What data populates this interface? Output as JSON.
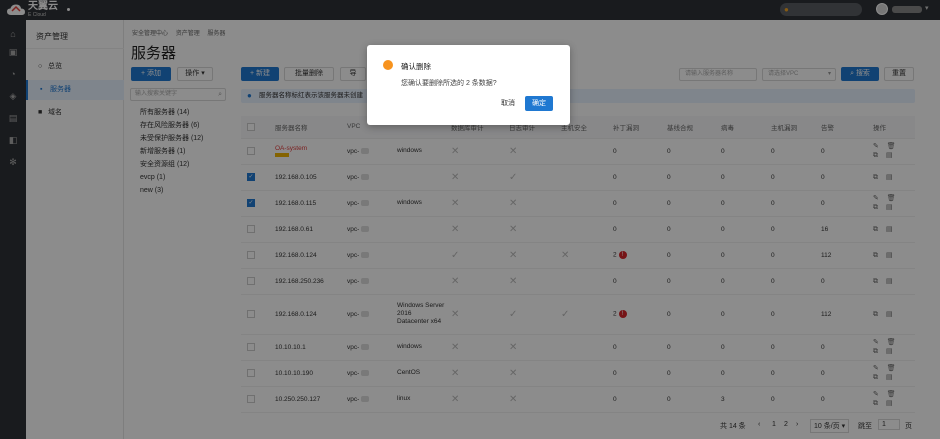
{
  "brand": {
    "name": "天翼云",
    "sub": "E Cloud"
  },
  "nav": {
    "title": "资产管理",
    "items": [
      {
        "icon": "radio-icon",
        "label": "总览"
      },
      {
        "icon": "server-icon",
        "label": "服务器"
      },
      {
        "icon": "square-icon",
        "label": "域名"
      }
    ]
  },
  "breadcrumb": [
    "安全管理中心",
    "资产管理",
    "服务器"
  ],
  "page": {
    "title": "服务器"
  },
  "left_toolbar": {
    "add_label": "+ 添加",
    "ops_label": "操作 ▾"
  },
  "group_search": {
    "placeholder": "输入搜索关键字"
  },
  "groups": [
    "所有服务器 (14)",
    "存在风险服务器 (6)",
    "未受保护服务器 (12)",
    "新增服务器 (1)",
    "安全资源组 (12)",
    "evcp (1)",
    "new (3)"
  ],
  "toolbar": {
    "new_label": "+ 新建",
    "batch_delete_label": "批量删除",
    "third_label": "导"
  },
  "filters": {
    "server_name_placeholder": "请输入服务器名称",
    "vpc_placeholder": "请选择VPC",
    "search_label": "搜索",
    "reset_label": "重置"
  },
  "info": {
    "text": "服务器名称标红表示该服务器未创建"
  },
  "table": {
    "headers": [
      "",
      "服务器名称",
      "VPC",
      "",
      "数据库审计",
      "日志审计",
      "主机安全",
      "补丁漏洞",
      "基线合规",
      "病毒",
      "主机漏洞",
      "告警",
      "操作"
    ],
    "rows": [
      {
        "checked": false,
        "name": "OA-system",
        "red": true,
        "tag": true,
        "vpc": "vpc-",
        "os": "windows",
        "db": "✕",
        "log": "✕",
        "host": "",
        "patch": "0",
        "warn": false,
        "baseline": "0",
        "virus": "0",
        "hostvul": "0",
        "alarm": "0",
        "ops": "✎ 🗑\n⧉ ▤",
        "tall": false
      },
      {
        "checked": true,
        "name": "192.168.0.105",
        "red": false,
        "tag": false,
        "vpc": "vpc-",
        "os": "",
        "db": "✕",
        "log": "✓",
        "host": "",
        "patch": "0",
        "warn": false,
        "baseline": "0",
        "virus": "0",
        "hostvul": "0",
        "alarm": "0",
        "ops": "⧉ ▤",
        "tall": false
      },
      {
        "checked": true,
        "name": "192.168.0.115",
        "red": false,
        "tag": false,
        "vpc": "vpc-",
        "os": "windows",
        "db": "✕",
        "log": "✕",
        "host": "",
        "patch": "0",
        "warn": false,
        "baseline": "0",
        "virus": "0",
        "hostvul": "0",
        "alarm": "0",
        "ops": "✎ 🗑\n⧉ ▤",
        "tall": false
      },
      {
        "checked": false,
        "name": "192.168.0.61",
        "red": false,
        "tag": false,
        "vpc": "vpc-",
        "os": "",
        "db": "✕",
        "log": "✕",
        "host": "",
        "patch": "0",
        "warn": false,
        "baseline": "0",
        "virus": "0",
        "hostvul": "0",
        "alarm": "16",
        "ops": "⧉ ▤",
        "tall": false
      },
      {
        "checked": false,
        "name": "192.168.0.124",
        "red": false,
        "tag": false,
        "vpc": "vpc-",
        "os": "",
        "db": "✓",
        "log": "✕",
        "host": "✕",
        "patch": "2",
        "warn": true,
        "baseline": "0",
        "virus": "0",
        "hostvul": "0",
        "alarm": "112",
        "ops": "⧉ ▤",
        "tall": false
      },
      {
        "checked": false,
        "name": "192.168.250.236",
        "red": false,
        "tag": false,
        "vpc": "vpc-",
        "os": "",
        "db": "✕",
        "log": "✕",
        "host": "",
        "patch": "0",
        "warn": false,
        "baseline": "0",
        "virus": "0",
        "hostvul": "0",
        "alarm": "0",
        "ops": "⧉ ▤",
        "tall": false
      },
      {
        "checked": false,
        "name": "192.168.0.124",
        "red": false,
        "tag": false,
        "vpc": "vpc-",
        "os": "Windows Server 2016 Datacenter x64",
        "db": "✕",
        "log": "✓",
        "host": "✓",
        "patch": "2",
        "warn": true,
        "baseline": "0",
        "virus": "0",
        "hostvul": "0",
        "alarm": "112",
        "ops": "⧉ ▤",
        "tall": true
      },
      {
        "checked": false,
        "name": "10.10.10.1",
        "red": false,
        "tag": false,
        "vpc": "vpc-",
        "os": "windows",
        "db": "✕",
        "log": "✕",
        "host": "",
        "patch": "0",
        "warn": false,
        "baseline": "0",
        "virus": "0",
        "hostvul": "0",
        "alarm": "0",
        "ops": "✎ 🗑\n⧉ ▤",
        "tall": false
      },
      {
        "checked": false,
        "name": "10.10.10.190",
        "red": false,
        "tag": false,
        "vpc": "vpc-",
        "os": "CentOS",
        "db": "✕",
        "log": "✕",
        "host": "",
        "patch": "0",
        "warn": false,
        "baseline": "0",
        "virus": "0",
        "hostvul": "0",
        "alarm": "0",
        "ops": "✎ 🗑\n⧉ ▤",
        "tall": false
      },
      {
        "checked": false,
        "name": "10.250.250.127",
        "red": false,
        "tag": false,
        "vpc": "vpc-",
        "os": "linux",
        "db": "✕",
        "log": "✕",
        "host": "",
        "patch": "0",
        "warn": false,
        "baseline": "0",
        "virus": "3",
        "hostvul": "0",
        "alarm": "0",
        "ops": "✎ 🗑\n⧉ ▤",
        "tall": false
      }
    ]
  },
  "pager": {
    "total": "共 14 条",
    "prev": "‹",
    "p1": "1",
    "p2": "2",
    "next": "›",
    "size": "10 条/页 ▾",
    "goto": "跳至",
    "goto_value": "1",
    "page_unit": "页"
  },
  "dialog": {
    "title": "确认删除",
    "message": "您确认要删除所选的 2 条数据?",
    "cancel_label": "取消",
    "ok_label": "确定"
  },
  "colors": {
    "primary": "#1f78d1",
    "topbar": "#2f3237",
    "danger": "#e03b3b",
    "warning": "#f7931e"
  }
}
